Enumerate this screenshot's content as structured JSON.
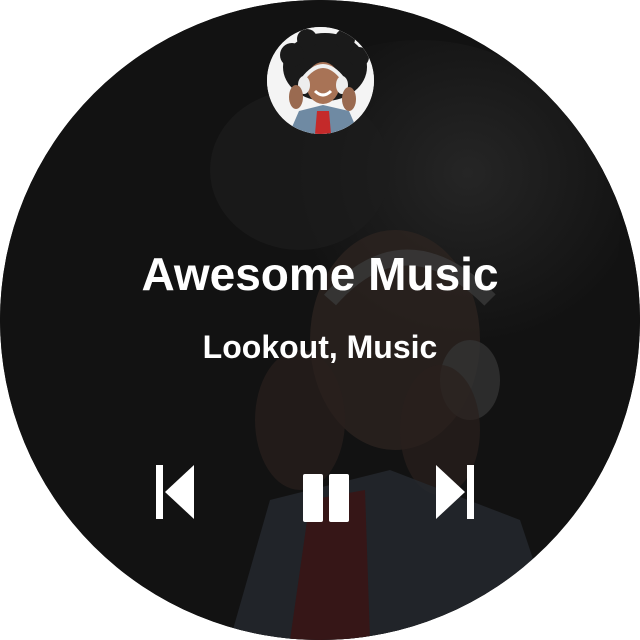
{
  "player": {
    "title": "Awesome Music",
    "artist": "Lookout, Music",
    "state": "playing"
  },
  "controls": {
    "previous_icon": "skip-previous-icon",
    "pause_icon": "pause-icon",
    "next_icon": "skip-next-icon"
  },
  "colors": {
    "background": "#121212",
    "text": "#ffffff",
    "icon": "#ffffff"
  }
}
